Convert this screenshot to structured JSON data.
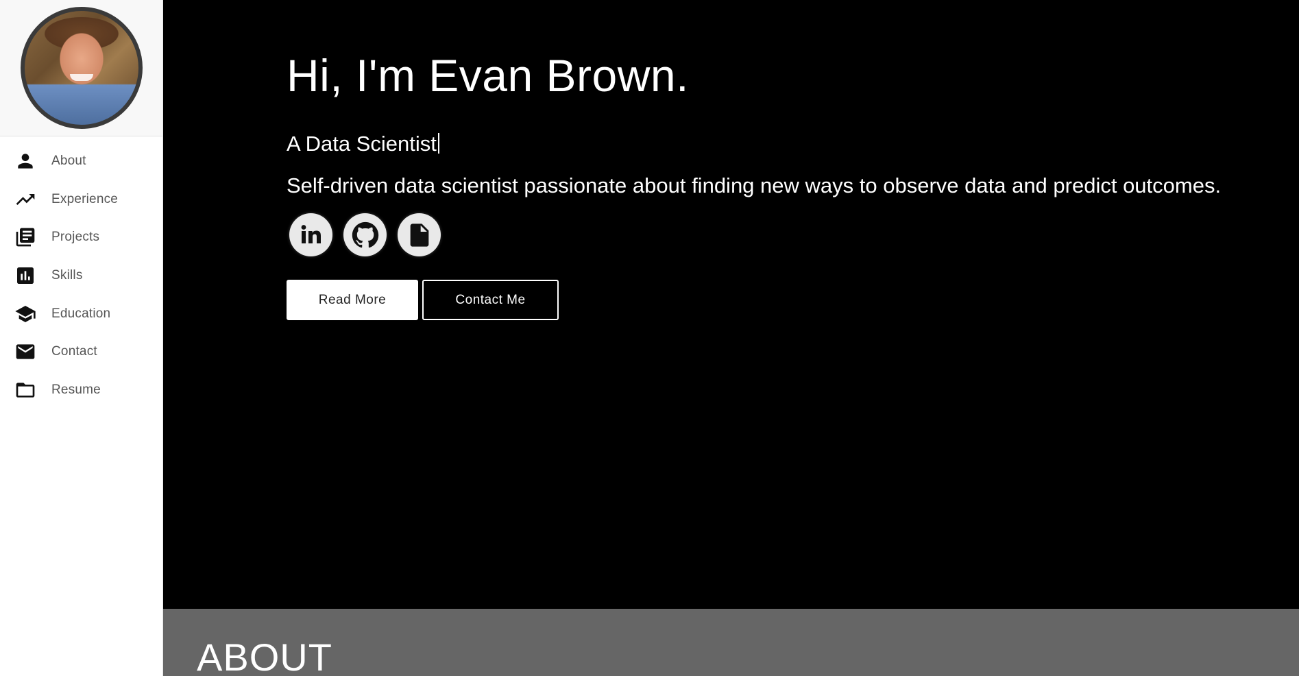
{
  "sidebar": {
    "nav": [
      {
        "label": "About",
        "icon": "person-icon"
      },
      {
        "label": "Experience",
        "icon": "trending-up-icon"
      },
      {
        "label": "Projects",
        "icon": "library-books-icon"
      },
      {
        "label": "Skills",
        "icon": "bar-chart-icon"
      },
      {
        "label": "Education",
        "icon": "graduation-cap-icon"
      },
      {
        "label": "Contact",
        "icon": "mail-icon"
      },
      {
        "label": "Resume",
        "icon": "folder-icon"
      }
    ]
  },
  "hero": {
    "title": "Hi, I'm Evan Brown.",
    "role": "A Data Scientist",
    "description": "Self-driven data scientist passionate about finding new ways to observe data and predict outcomes.",
    "socials": [
      {
        "icon": "linkedin-icon"
      },
      {
        "icon": "github-icon"
      },
      {
        "icon": "document-icon"
      }
    ],
    "buttons": {
      "read_more": "Read More",
      "contact_me": "Contact Me"
    }
  },
  "about": {
    "title": "ABOUT"
  },
  "colors": {
    "hero_background": "#000000",
    "about_background": "#666666",
    "sidebar_background": "#ffffff",
    "nav_text": "#555555"
  }
}
